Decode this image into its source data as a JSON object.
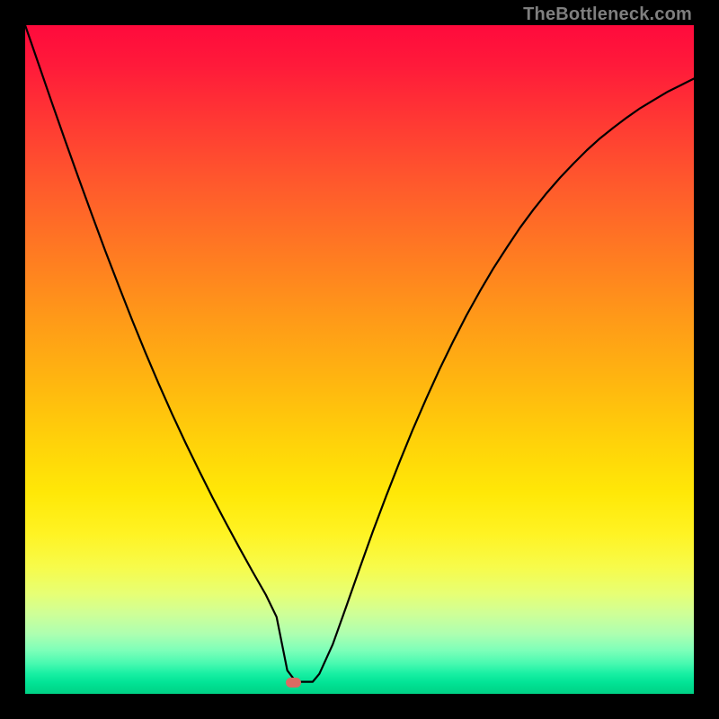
{
  "watermark": "TheBottleneck.com",
  "marker": {
    "cx_frac": 0.401,
    "cy_frac": 0.983
  },
  "chart_data": {
    "type": "line",
    "title": "",
    "xlabel": "",
    "ylabel": "",
    "xlim": [
      0,
      1
    ],
    "ylim": [
      0,
      1
    ],
    "series": [
      {
        "name": "curve",
        "x": [
          0.0,
          0.02,
          0.04,
          0.06,
          0.08,
          0.1,
          0.12,
          0.14,
          0.16,
          0.18,
          0.2,
          0.22,
          0.24,
          0.26,
          0.28,
          0.3,
          0.32,
          0.34,
          0.36,
          0.376,
          0.384,
          0.392,
          0.405,
          0.42,
          0.43,
          0.44,
          0.46,
          0.48,
          0.5,
          0.52,
          0.54,
          0.56,
          0.58,
          0.6,
          0.62,
          0.64,
          0.66,
          0.68,
          0.7,
          0.72,
          0.74,
          0.76,
          0.78,
          0.8,
          0.82,
          0.84,
          0.86,
          0.88,
          0.9,
          0.92,
          0.94,
          0.96,
          0.98,
          1.0
        ],
        "y": [
          1.0,
          0.942,
          0.884,
          0.827,
          0.771,
          0.716,
          0.662,
          0.61,
          0.559,
          0.51,
          0.463,
          0.418,
          0.375,
          0.334,
          0.294,
          0.256,
          0.219,
          0.183,
          0.148,
          0.115,
          0.075,
          0.035,
          0.018,
          0.018,
          0.018,
          0.03,
          0.074,
          0.13,
          0.187,
          0.243,
          0.296,
          0.347,
          0.396,
          0.442,
          0.486,
          0.527,
          0.566,
          0.602,
          0.636,
          0.667,
          0.697,
          0.724,
          0.749,
          0.772,
          0.793,
          0.813,
          0.831,
          0.847,
          0.862,
          0.876,
          0.888,
          0.9,
          0.91,
          0.92
        ]
      }
    ],
    "annotations": [
      {
        "name": "min-marker",
        "x": 0.401,
        "y": 0.017
      }
    ],
    "background_gradient": {
      "direction": "vertical",
      "stops": [
        {
          "pos": 0.0,
          "color": "#ff0a3c"
        },
        {
          "pos": 0.5,
          "color": "#ffc60c"
        },
        {
          "pos": 0.8,
          "color": "#f3fc4e"
        },
        {
          "pos": 1.0,
          "color": "#00d286"
        }
      ]
    }
  }
}
